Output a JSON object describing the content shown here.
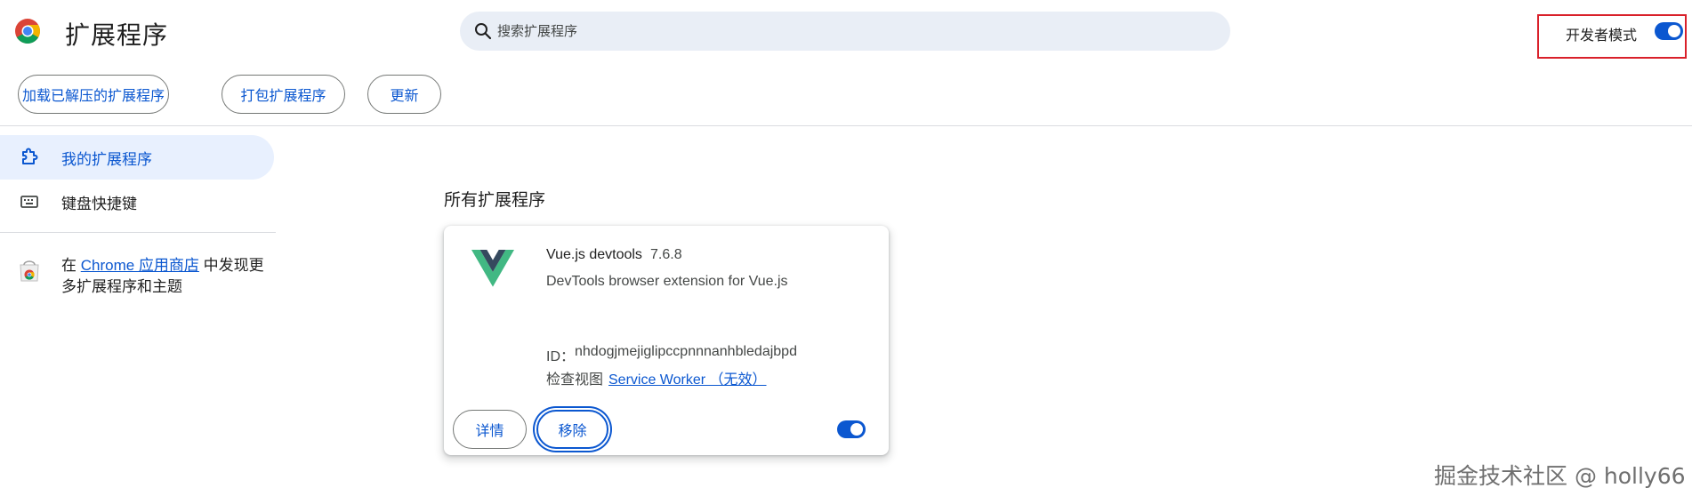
{
  "header": {
    "title": "扩展程序",
    "search": {
      "placeholder": "搜索扩展程序",
      "value": ""
    },
    "developer_mode": {
      "label": "开发者模式",
      "enabled": true
    }
  },
  "toolbar": {
    "load_unpacked_label": "加载已解压的扩展程序",
    "pack_label": "打包扩展程序",
    "update_label": "更新"
  },
  "sidebar": {
    "items": [
      {
        "label": "我的扩展程序",
        "selected": true,
        "icon": "puzzle-icon"
      },
      {
        "label": "键盘快捷键",
        "selected": false,
        "icon": "keyboard-icon"
      }
    ],
    "store_prefix": "在 ",
    "store_link": "Chrome 应用商店",
    "store_suffix": " 中发现更多扩展程序和主题"
  },
  "main": {
    "section_title": "所有扩展程序",
    "extension": {
      "name": "Vue.js devtools",
      "version": "7.6.8",
      "description": "DevTools browser extension for Vue.js",
      "id_label": "ID：",
      "id_value": "nhdogjmejiglipccpnnnanhbledajbpd",
      "inspect_label": "检查视图",
      "inspect_link": "Service Worker （无效）",
      "details_label": "详情",
      "remove_label": "移除",
      "enabled": true
    }
  },
  "watermark": "掘金技术社区 @ holly66",
  "colors": {
    "accent": "#0b57d0",
    "selected_bg": "#e8f0fe",
    "search_bg": "#e9eef6",
    "highlight_border": "#d9202a"
  }
}
